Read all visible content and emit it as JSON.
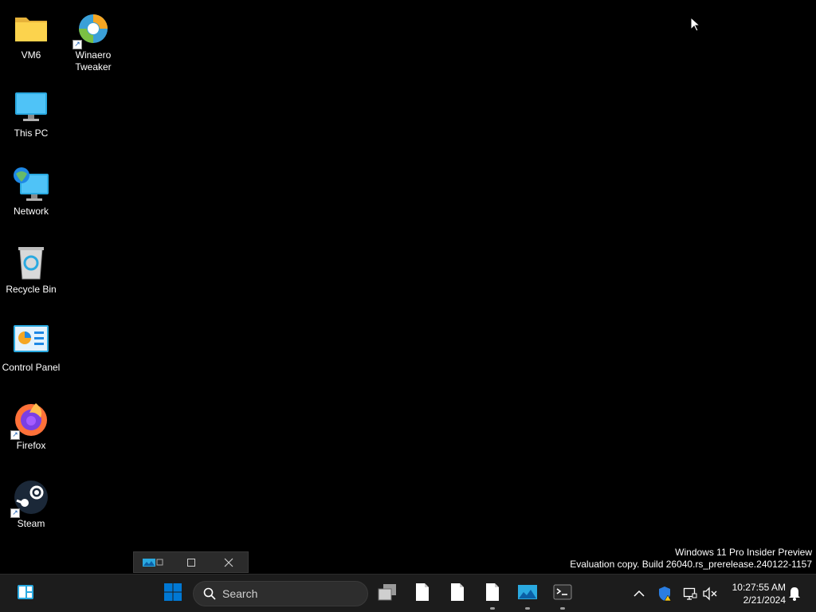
{
  "desktop": {
    "icons": [
      {
        "label": "VM6",
        "icon": "folder-icon"
      },
      {
        "label": "Winaero\nTweaker",
        "icon": "winaero-tweaker-icon",
        "shortcut": true
      },
      {
        "label": "This PC",
        "icon": "this-pc-icon"
      },
      {
        "label": "Network",
        "icon": "network-icon"
      },
      {
        "label": "Recycle Bin",
        "icon": "recycle-bin-icon"
      },
      {
        "label": "Control Panel",
        "icon": "control-panel-icon"
      },
      {
        "label": "Firefox",
        "icon": "firefox-icon",
        "shortcut": true
      },
      {
        "label": "Steam",
        "icon": "steam-icon",
        "shortcut": true
      }
    ],
    "shortcut_arrow": "↗"
  },
  "watermark": {
    "line1": "Windows 11 Pro Insider Preview",
    "line2": "Evaluation copy. Build 26040.rs_prerelease.240122-1157"
  },
  "taskbar": {
    "search": {
      "placeholder": "Search"
    },
    "clock": {
      "time": "10:27:55 AM",
      "date": "2/21/2024"
    },
    "apps": [
      "widgets-icon",
      "start-icon",
      "task-view-icon",
      "file-icon",
      "file-icon",
      "file-icon",
      "image-viewer-icon",
      "terminal-icon"
    ],
    "tray": [
      "chevron-up-icon",
      "windows-security-icon",
      "network-status-icon",
      "volume-muted-icon",
      "notification-bell-icon"
    ]
  },
  "colors": {
    "accent": "#0078d4",
    "taskbar": "#1c1c1c",
    "background": "#000000"
  }
}
